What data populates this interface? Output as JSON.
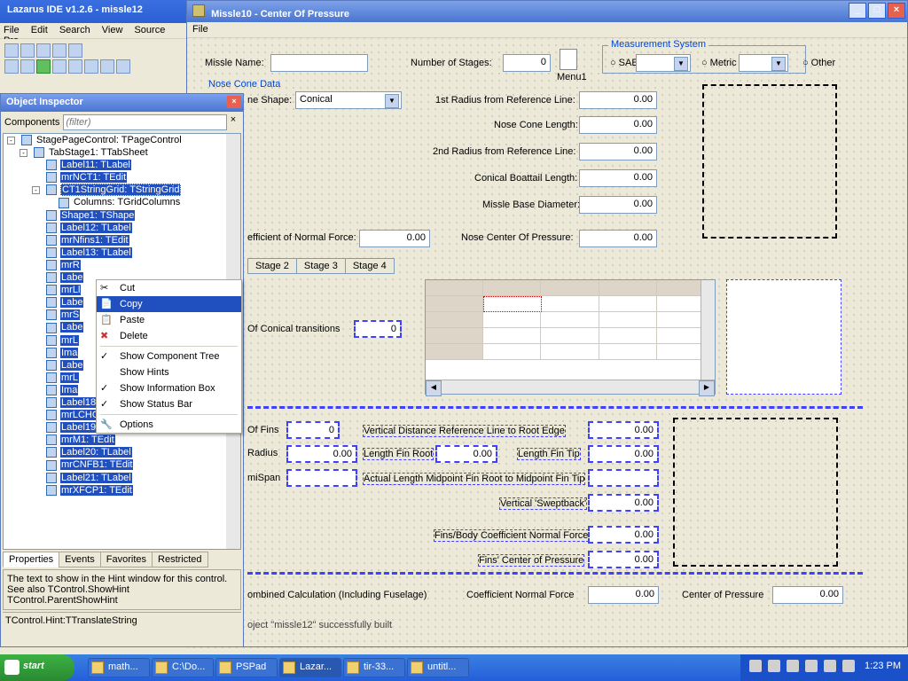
{
  "ide": {
    "title": "Lazarus IDE v1.2.6 - missle12",
    "menus": [
      "File",
      "Edit",
      "Search",
      "View",
      "Source",
      "Pro"
    ]
  },
  "form": {
    "title": "Missle10 - Center Of Pressure",
    "menu_file": "File",
    "missle_name_lbl": "Missle Name:",
    "num_stages_lbl": "Number of Stages:",
    "num_stages_val": "0",
    "menu1": "Menu1",
    "meas_group": "Measurement System",
    "sae": "SAE",
    "metric": "Metric",
    "other": "Other",
    "nose_group": "Nose Cone Data",
    "shape_lbl": "ne Shape:",
    "shape_val": "Conical",
    "r1_lbl": "1st Radius from Reference Line:",
    "r1": "0.00",
    "len_lbl": "Nose Cone Length:",
    "len": "0.00",
    "r2_lbl": "2nd Radius from Reference Line:",
    "r2": "0.00",
    "boat_lbl": "Conical Boattail Length:",
    "boat": "0.00",
    "base_lbl": "Missle Base Diameter:",
    "base": "0.00",
    "cnf_lbl": "efficient of Normal Force:",
    "cnf": "0.00",
    "ncp_lbl": "Nose Center Of Pressure:",
    "ncp": "0.00",
    "tabs": [
      "Stage 2",
      "Stage 3",
      "Stage 4"
    ],
    "conical_trans_lbl": "Of Conical transitions",
    "conical_trans": "0",
    "fins_lbl": "Of Fins",
    "fins": "0",
    "vert_dist_lbl": "Vertical Distance Reference Line to Root Edge",
    "vert_dist": "0.00",
    "radius_lbl": "Radius",
    "radius": "0.00",
    "len_root_lbl": "Length Fin Root",
    "len_root": "0.00",
    "len_tip_lbl": "Length Fin Tip",
    "len_tip": "0.00",
    "mispan_lbl": "miSpan",
    "mispan": "",
    "actual_len_lbl": "Actual Length Midpoint Fin Root to Midpoint Fin Tip",
    "vert_swept_lbl": "Vertical 'Sweptback'",
    "vert_swept": "0.00",
    "fbcnf_lbl": "Fins/Body Coefficient Normal Force",
    "fbcnf": "0.00",
    "fcp_lbl": "Fins' Center of Pressure",
    "fcp": "0.00",
    "combined_lbl": "ombined Calculation (Including Fuselage)",
    "coeff_nf_lbl": "Coefficient Normal Force",
    "coeff_nf": "0.00",
    "cop_lbl": "Center of Pressure",
    "cop": "0.00"
  },
  "oi": {
    "title": "Object Inspector",
    "components_lbl": "Components",
    "filter_ph": "(filter)",
    "tree": [
      {
        "lv": 0,
        "t": "StagePageControl: TPageControl",
        "sel": false,
        "exp": "-"
      },
      {
        "lv": 1,
        "t": "TabStage1: TTabSheet",
        "sel": false,
        "exp": "-"
      },
      {
        "lv": 2,
        "t": "Label11: TLabel",
        "sel": true
      },
      {
        "lv": 2,
        "t": "mrNCT1: TEdit",
        "sel": true
      },
      {
        "lv": 2,
        "t": "CT1StringGrid: TStringGrid",
        "sel": true,
        "ctx": true,
        "exp": "-"
      },
      {
        "lv": 3,
        "t": "Columns: TGridColumns",
        "sel": false
      },
      {
        "lv": 2,
        "t": "Shape1: TShape",
        "sel": true
      },
      {
        "lv": 2,
        "t": "Label12: TLabel",
        "sel": true
      },
      {
        "lv": 2,
        "t": "mrNfins1: TEdit",
        "sel": true
      },
      {
        "lv": 2,
        "t": "Label13: TLabel",
        "sel": true
      },
      {
        "lv": 2,
        "t": "mrR",
        "sel": true
      },
      {
        "lv": 2,
        "t": "Labe",
        "sel": true
      },
      {
        "lv": 2,
        "t": "mrLl",
        "sel": true
      },
      {
        "lv": 2,
        "t": "Labe",
        "sel": true
      },
      {
        "lv": 2,
        "t": "mrS",
        "sel": true
      },
      {
        "lv": 2,
        "t": "Labe",
        "sel": true
      },
      {
        "lv": 2,
        "t": "mrL",
        "sel": true
      },
      {
        "lv": 2,
        "t": "Ima",
        "sel": true
      },
      {
        "lv": 2,
        "t": "Labe",
        "sel": true
      },
      {
        "lv": 2,
        "t": "mrL",
        "sel": true
      },
      {
        "lv": 2,
        "t": "Ima",
        "sel": true
      },
      {
        "lv": 2,
        "t": "Label18: TLabel",
        "sel": true
      },
      {
        "lv": 2,
        "t": "mrLCHORD1: TEdit",
        "sel": true
      },
      {
        "lv": 2,
        "t": "Label19: TLabel",
        "sel": true
      },
      {
        "lv": 2,
        "t": "mrM1: TEdit",
        "sel": true
      },
      {
        "lv": 2,
        "t": "Label20: TLabel",
        "sel": true
      },
      {
        "lv": 2,
        "t": "mrCNFB1: TEdit",
        "sel": true
      },
      {
        "lv": 2,
        "t": "Label21: TLabel",
        "sel": true
      },
      {
        "lv": 2,
        "t": "mrXFCP1: TEdit",
        "sel": true
      }
    ],
    "tabs": [
      "Properties",
      "Events",
      "Favorites",
      "Restricted"
    ],
    "desc": "The text to show in the Hint window for this control. See also TControl.ShowHint TControl.ParentShowHint",
    "desc2": "TControl.Hint:TTranslateString",
    "status": "oject \"missle12\" successfully built"
  },
  "ctx": {
    "items": [
      "Cut",
      "Copy",
      "Paste",
      "Delete",
      "Show Component Tree",
      "Show Hints",
      "Show Information Box",
      "Show Status Bar",
      "Options"
    ]
  },
  "taskbar": {
    "start": "start",
    "tasks": [
      "math...",
      "C:\\Do...",
      "PSPad",
      "Lazar...",
      "tir-33...",
      "untitl..."
    ],
    "clock": "1:23 PM"
  }
}
